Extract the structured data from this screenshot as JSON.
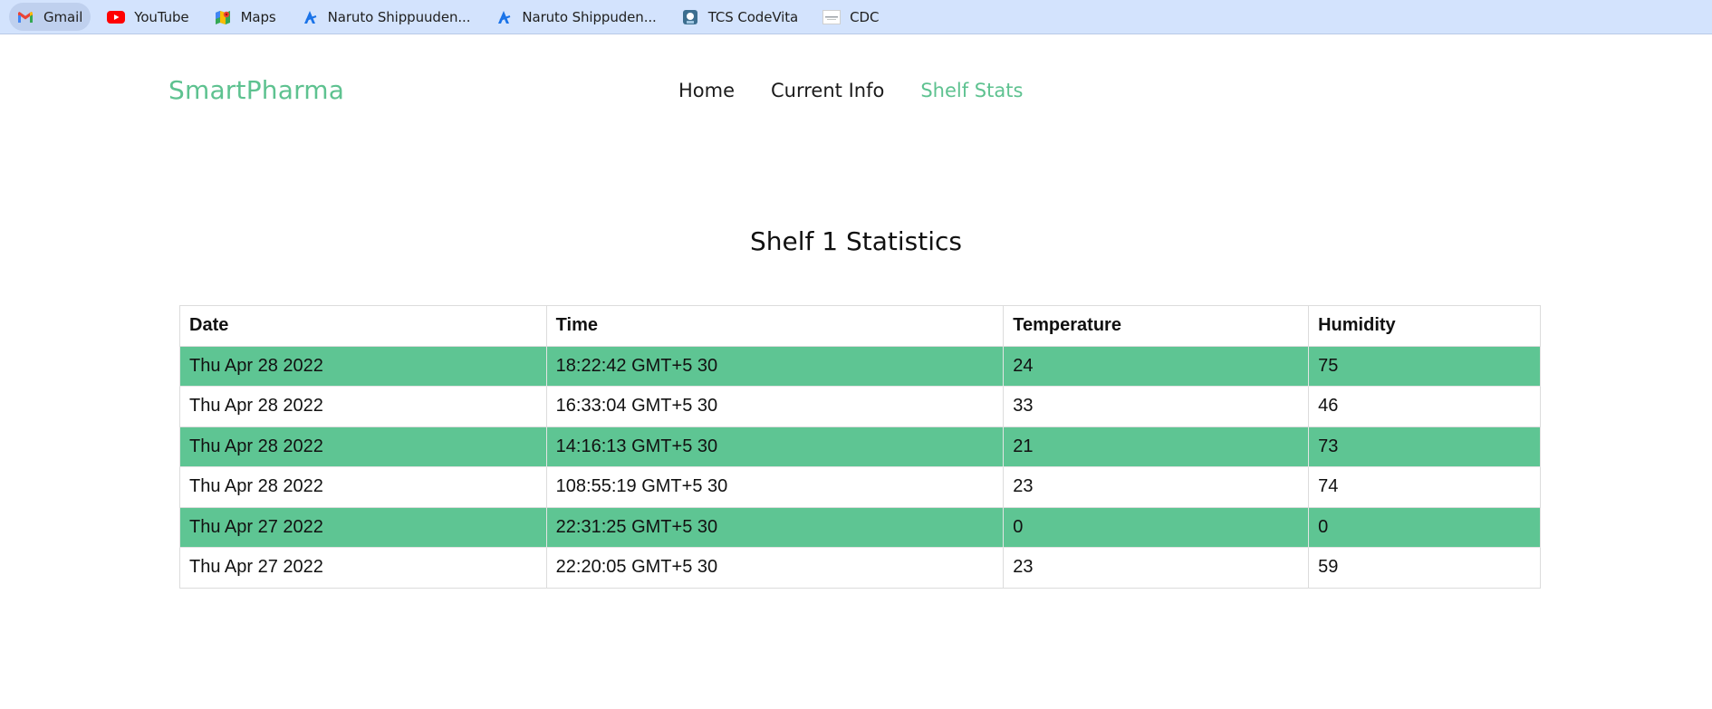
{
  "bookmarks": [
    {
      "label": "Gmail",
      "icon": "gmail-icon",
      "active": true
    },
    {
      "label": "YouTube",
      "icon": "youtube-icon"
    },
    {
      "label": "Maps",
      "icon": "maps-icon"
    },
    {
      "label": "Naruto Shippuuden...",
      "icon": "anime-icon"
    },
    {
      "label": "Naruto Shippuden...",
      "icon": "anime-icon"
    },
    {
      "label": "TCS CodeVita",
      "icon": "codevita-icon"
    },
    {
      "label": "CDC",
      "icon": "cdc-icon"
    }
  ],
  "site": {
    "brand": "SmartPharma",
    "nav": [
      {
        "label": "Home"
      },
      {
        "label": "Current Info"
      },
      {
        "label": "Shelf Stats",
        "current": true
      }
    ],
    "accent_color": "#5ec290"
  },
  "page": {
    "title": "Shelf 1 Statistics"
  },
  "table": {
    "headers": [
      "Date",
      "Time",
      "Temperature",
      "Humidity"
    ],
    "rows": [
      [
        "Thu Apr 28 2022",
        "18:22:42 GMT+5 30",
        "24",
        "75"
      ],
      [
        "Thu Apr 28 2022",
        "16:33:04 GMT+5 30",
        "33",
        "46"
      ],
      [
        "Thu Apr 28 2022",
        "14:16:13 GMT+5 30",
        "21",
        "73"
      ],
      [
        "Thu Apr 28 2022",
        "108:55:19 GMT+5 30",
        "23",
        "74"
      ],
      [
        "Thu Apr 27 2022",
        "22:31:25 GMT+5 30",
        "0",
        "0"
      ],
      [
        "Thu Apr 27 2022",
        "22:20:05 GMT+5 30",
        "23",
        "59"
      ]
    ],
    "stripe_color": "#5ec593"
  }
}
